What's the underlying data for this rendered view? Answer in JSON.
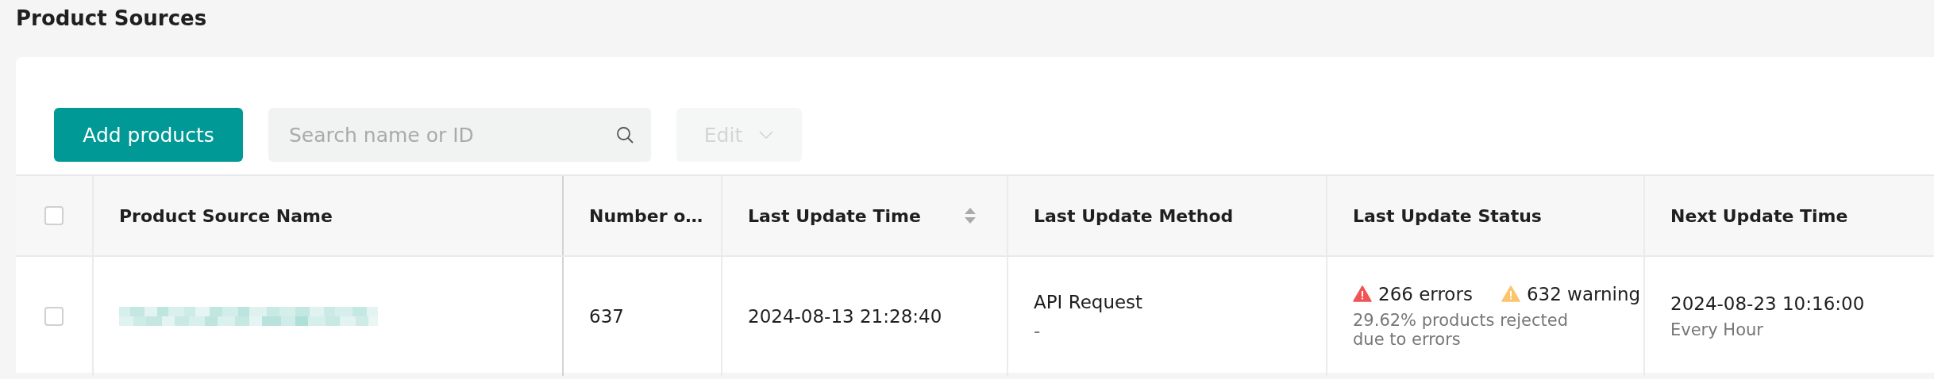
{
  "page_title": "Product Sources",
  "toolbar": {
    "add_button": "Add products",
    "search": {
      "placeholder": "Search name or ID"
    },
    "edit_button": {
      "label": "Edit",
      "disabled": true
    }
  },
  "table": {
    "select_all": {
      "checked": false
    },
    "columns": [
      {
        "label": "Product Source Name",
        "sortable": false
      },
      {
        "label": "Number o…",
        "sortable": false
      },
      {
        "label": "Last Update Time",
        "sortable": true
      },
      {
        "label": "Last Update Method",
        "sortable": false
      },
      {
        "label": "Last Update Status",
        "sortable": false
      },
      {
        "label": "Next Update Time",
        "sortable": false
      }
    ],
    "rows": [
      {
        "checked": false,
        "number": "637",
        "last_update_time": "2024-08-13 21:28:40",
        "method": "API Request",
        "method_detail": "-",
        "errors": "266 errors",
        "warnings": "632 warning",
        "status_note": "29.62%  products rejected due to errors",
        "next_update_time": "2024-08-23 10:16:00",
        "frequency": "Every Hour"
      }
    ]
  }
}
